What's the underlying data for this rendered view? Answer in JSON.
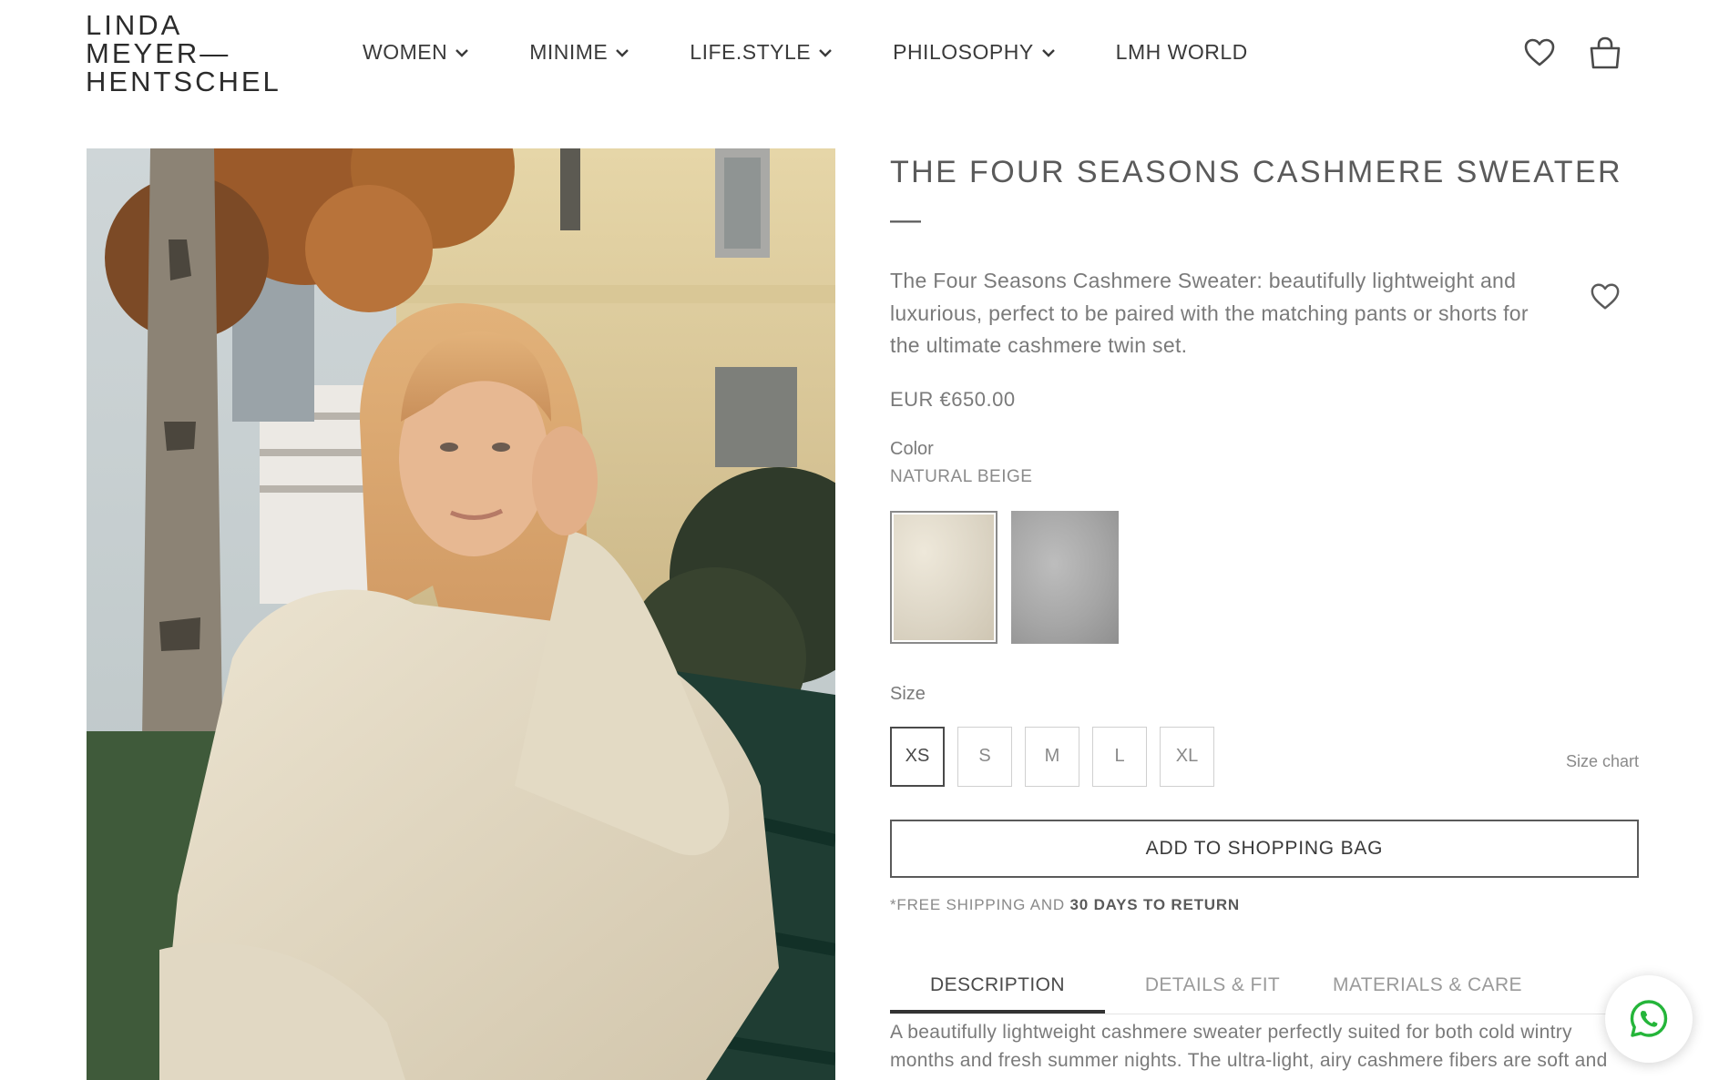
{
  "brand": {
    "logo_lines": [
      "LINDA",
      "MEYER—",
      "HENTSCHEL"
    ]
  },
  "nav": {
    "items": [
      {
        "label": "WOMEN",
        "has_dropdown": true
      },
      {
        "label": "MINIME",
        "has_dropdown": true
      },
      {
        "label": "LIFE.STYLE",
        "has_dropdown": true
      },
      {
        "label": "PHILOSOPHY",
        "has_dropdown": true
      },
      {
        "label": "LMH WORLD",
        "has_dropdown": false
      }
    ]
  },
  "header_icons": [
    "heart-icon",
    "shopping-bag-icon"
  ],
  "product": {
    "title": "THE FOUR SEASONS CASHMERE SWEATER —",
    "summary": "The Four Seasons Cashmere Sweater: beautifully lightweight and luxurious, perfect to be paired with the matching pants or shorts for the ultimate cashmere twin set.",
    "price": "EUR €650.00",
    "color_label": "Color",
    "color_value": "NATURAL BEIGE",
    "swatches": [
      {
        "name": "natural-beige",
        "color": "#ddd6c6",
        "selected": true
      },
      {
        "name": "grey",
        "color": "#a6a6a6",
        "selected": false
      }
    ],
    "size_label": "Size",
    "sizes": [
      "XS",
      "S",
      "M",
      "L",
      "XL"
    ],
    "selected_size": "XS",
    "size_chart_label": "Size chart",
    "add_to_bag_label": "ADD TO SHOPPING BAG",
    "shipping_note_prefix": "*FREE SHIPPING AND ",
    "shipping_note_bold": "30 DAYS TO RETURN",
    "tabs": [
      {
        "label": "DESCRIPTION",
        "active": true
      },
      {
        "label": "DETAILS & FIT",
        "active": false
      },
      {
        "label": "MATERIALS & CARE",
        "active": false
      }
    ],
    "description": "A beautifully lightweight cashmere sweater perfectly suited for both cold wintry months and fresh summer nights. The ultra-light, airy cashmere fibers are soft and smooth maintaining a perfect body temperature whatever the season, so it can be worn directly against your skin for a cozy, no-fuss look. This sweater follows a classic"
  },
  "colors": {
    "text_dark": "#3a3a3a",
    "text_muted": "#7a7a7a",
    "whatsapp_green": "#25b53a"
  }
}
